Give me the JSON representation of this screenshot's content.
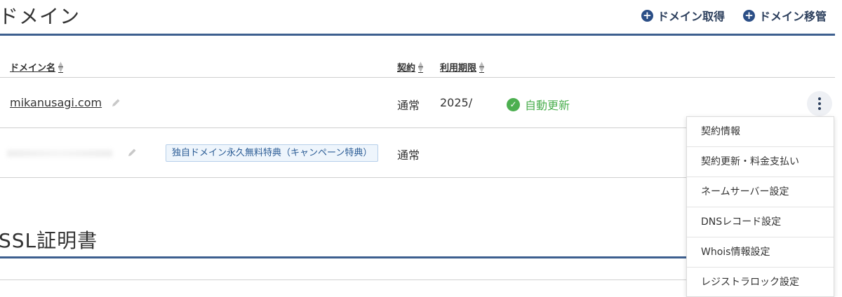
{
  "domain_section": {
    "title": "ドメイン",
    "actions": [
      {
        "icon": "plus-circle-icon",
        "label": "ドメイン取得"
      },
      {
        "icon": "plus-circle-icon",
        "label": "ドメイン移管"
      }
    ],
    "columns": {
      "name": "ドメイン名",
      "contract": "契約",
      "expiry": "利用期限"
    },
    "rows": [
      {
        "domain": "mikanusagi.com",
        "contract": "通常",
        "expiry": "2025/",
        "status": "自動更新"
      },
      {
        "domain": "",
        "badge": "独自ドメイン永久無料特典（キャンペーン特典）",
        "contract": "通常"
      }
    ]
  },
  "ssl_section": {
    "title": "SSL証明書"
  },
  "dropdown_menu": {
    "items": [
      "契約情報",
      "契約更新・料金支払い",
      "ネームサーバー設定",
      "DNSレコード設定",
      "Whois情報設定",
      "レジストラロック設定"
    ]
  },
  "colors": {
    "accent": "#3d5f8f",
    "action_icon": "#2b4e86",
    "status_green": "#4caf50",
    "badge_bg": "#eef5fc"
  }
}
